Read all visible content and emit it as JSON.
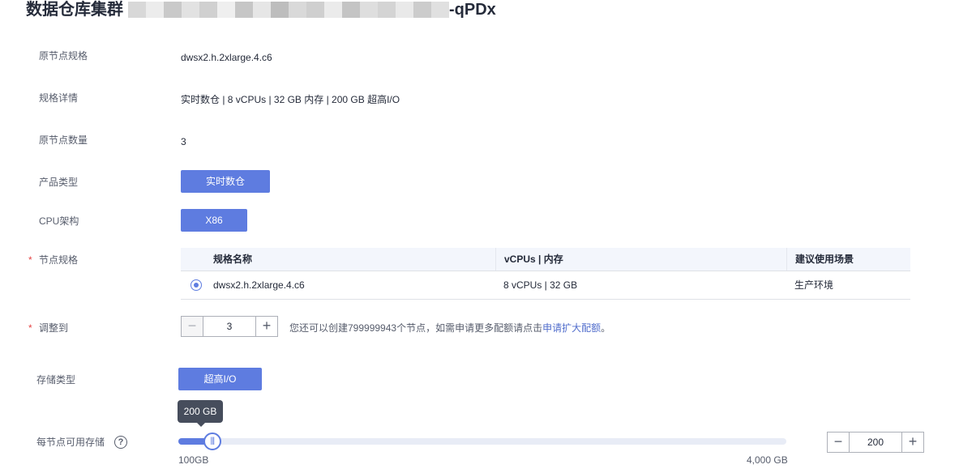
{
  "header": {
    "title_prefix": "数据仓库集群",
    "title_suffix": "-qPDx",
    "mask_colors": [
      "#d8d8d8",
      "#ececec",
      "#c9c9c9",
      "#e2e2e2",
      "#d0d0d0",
      "#efefef",
      "#c6c6c6",
      "#e6e6e6",
      "#bdbdbd",
      "#d9d9d9",
      "#cfcfcf",
      "#ebebeb",
      "#c4c4c4",
      "#dedede",
      "#d4d4d4",
      "#e9e9e9",
      "#cccccc",
      "#e0e0e0"
    ]
  },
  "fields": {
    "orig_spec": {
      "label": "原节点规格",
      "value": "dwsx2.h.2xlarge.4.c6"
    },
    "spec_detail": {
      "label": "规格详情",
      "value": "实时数仓 | 8 vCPUs | 32 GB 内存 | 200 GB 超高I/O"
    },
    "orig_count": {
      "label": "原节点数量",
      "value": "3"
    },
    "product_type": {
      "label": "产品类型",
      "option": "实时数仓"
    },
    "cpu_arch": {
      "label": "CPU架构",
      "option": "X86"
    },
    "node_spec": {
      "required_mark": "*",
      "label": "节点规格",
      "columns": [
        "规格名称",
        "vCPUs | 内存",
        "建议使用场景"
      ],
      "rows": [
        {
          "name": "dwsx2.h.2xlarge.4.c6",
          "vcpu_mem": "8 vCPUs | 32 GB",
          "scenario": "生产环境",
          "selected": true
        }
      ]
    },
    "resize_to": {
      "required_mark": "*",
      "label": "调整到",
      "value": "3",
      "minus": "−",
      "plus": "+",
      "hint": "您还可以创建799999943个节点，如需申请更多配额请点击",
      "hint_link": "申请扩大配额",
      "hint_end": "。"
    },
    "storage_type": {
      "label": "存储类型",
      "option": "超高I/O"
    },
    "storage_per_node": {
      "label": "每节点可用存储",
      "help_icon": "?",
      "tooltip": "200 GB",
      "slider_fraction": 0.041,
      "min_label": "100GB",
      "max_label": "4,000 GB",
      "value": "200",
      "minus": "−",
      "plus": "+"
    }
  },
  "colors": {
    "primary": "#5e7ce0",
    "required": "#e54545",
    "link": "#526ecc"
  }
}
